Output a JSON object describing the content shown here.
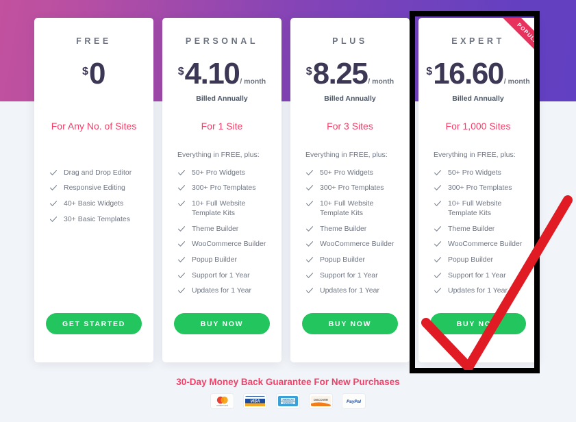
{
  "background": {
    "gradient_start": "#c2519f",
    "gradient_end": "#6140c1",
    "page_bg": "#f1f4f8"
  },
  "theme": {
    "price_color": "#3b3755",
    "accent_pink": "#f43f68",
    "cta_green": "#22c55e",
    "ribbon_color": "#e8325e",
    "feature_text": "#6e7582",
    "annotation_red": "#e01b24",
    "annotation_box": "#000000"
  },
  "plans": [
    {
      "name": "FREE",
      "currency": "$",
      "amount": "0",
      "per": "",
      "billed": "",
      "sites": "For Any No. of Sites",
      "plus_note": "",
      "features": [
        "Drag and Drop Editor",
        "Responsive Editing",
        "40+ Basic Widgets",
        "30+ Basic Templates"
      ],
      "cta": "GET STARTED",
      "popular": false,
      "ribbon_label": ""
    },
    {
      "name": "PERSONAL",
      "currency": "$",
      "amount": "4.10",
      "per": "/ month",
      "billed": "Billed Annually",
      "sites": "For 1 Site",
      "plus_note": "Everything in FREE, plus:",
      "features": [
        "50+ Pro Widgets",
        "300+ Pro Templates",
        "10+ Full Website Template Kits",
        "Theme Builder",
        "WooCommerce Builder",
        "Popup Builder",
        "Support for 1 Year",
        "Updates for 1 Year"
      ],
      "cta": "BUY NOW",
      "popular": false,
      "ribbon_label": ""
    },
    {
      "name": "PLUS",
      "currency": "$",
      "amount": "8.25",
      "per": "/ month",
      "billed": "Billed Annually",
      "sites": "For 3 Sites",
      "plus_note": "Everything in FREE, plus:",
      "features": [
        "50+ Pro Widgets",
        "300+ Pro Templates",
        "10+ Full Website Template Kits",
        "Theme Builder",
        "WooCommerce Builder",
        "Popup Builder",
        "Support for 1 Year",
        "Updates for 1 Year"
      ],
      "cta": "BUY NOW",
      "popular": false,
      "ribbon_label": ""
    },
    {
      "name": "EXPERT",
      "currency": "$",
      "amount": "16.60",
      "per": "/ month",
      "billed": "Billed Annually",
      "sites": "For 1,000 Sites",
      "plus_note": "Everything in FREE, plus:",
      "features": [
        "50+ Pro Widgets",
        "300+ Pro Templates",
        "10+ Full Website Template Kits",
        "Theme Builder",
        "WooCommerce Builder",
        "Popup Builder",
        "Support for 1 Year",
        "Updates for 1 Year"
      ],
      "cta": "BUY NOW",
      "popular": true,
      "ribbon_label": "POPULAR"
    }
  ],
  "footer": {
    "guarantee": "30-Day Money Back Guarantee For New Purchases",
    "payment_methods": [
      {
        "name": "mastercard-icon",
        "label": "mastercard"
      },
      {
        "name": "visa-icon",
        "label": "VISA"
      },
      {
        "name": "amex-icon",
        "label": "AMERICAN EXPRESS"
      },
      {
        "name": "discover-icon",
        "label": "DISCOVER"
      },
      {
        "name": "paypal-icon",
        "label": "PayPal"
      }
    ]
  },
  "annotations": {
    "highlight_box_target": "EXPERT",
    "check_mark_target": "BUY NOW"
  }
}
